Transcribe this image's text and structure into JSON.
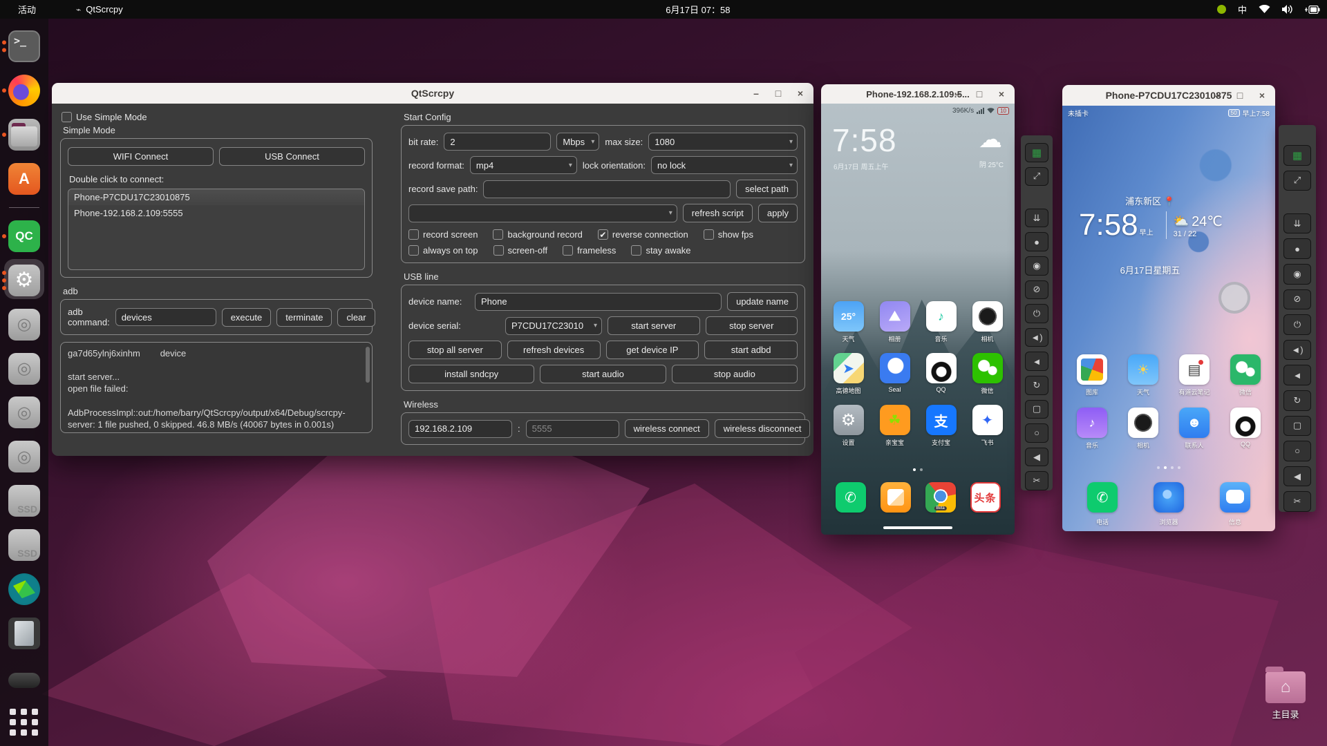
{
  "colors": {
    "topbar": "#0d0d0d",
    "titlebar": "#f3f1ef",
    "window_bg": "#3b3b3b",
    "accent_orange": "#e95420",
    "dock_bg": "rgba(20,14,20,0.82)"
  },
  "topbar": {
    "activities": "活动",
    "app_name": "QtScrcpy",
    "app_glyph": "⌁",
    "clock": "6月17日 07：58",
    "input_method": "中",
    "tray": [
      {
        "icon": "android-icon"
      },
      {
        "icon": "input-method-indicator"
      },
      {
        "icon": "wifi-icon"
      },
      {
        "icon": "volume-icon"
      },
      {
        "icon": "battery-icon"
      }
    ]
  },
  "dock": {
    "items": [
      {
        "name": "terminal",
        "style": "terminal",
        "glyph": ">_",
        "dots": 2
      },
      {
        "name": "firefox",
        "style": "firefox",
        "dots": 1
      },
      {
        "name": "files",
        "style": "files",
        "dots": 1
      },
      {
        "name": "ubuntu-software",
        "style": "soft",
        "glyph": "A",
        "dots": 0
      },
      {
        "name": "separator"
      },
      {
        "name": "qtcreator",
        "style": "qc",
        "glyph": "QC",
        "dots": 1
      },
      {
        "name": "settings-gear",
        "style": "gear",
        "glyph": "⚙",
        "dots": 3,
        "active": true
      },
      {
        "name": "disk-1",
        "style": "disk",
        "glyph": "◎",
        "dots": 0
      },
      {
        "name": "disk-2",
        "style": "disk",
        "glyph": "◎",
        "dots": 0
      },
      {
        "name": "disk-3",
        "style": "disk",
        "glyph": "◎",
        "dots": 0
      },
      {
        "name": "disk-4",
        "style": "disk",
        "glyph": "◎",
        "dots": 0
      },
      {
        "name": "ssd-1",
        "style": "ssd",
        "glyph": "SSD",
        "dots": 0
      },
      {
        "name": "ssd-2",
        "style": "ssd",
        "glyph": "SSD",
        "dots": 0
      },
      {
        "name": "remote-tool",
        "style": "origami",
        "dots": 0
      },
      {
        "name": "phone-device",
        "style": "phone",
        "dots": 0
      },
      {
        "name": "drive-pill",
        "style": "pill",
        "dots": 0
      },
      {
        "name": "show-apps",
        "style": "grid",
        "dots": 0
      }
    ]
  },
  "main_window": {
    "title": "QtScrcpy",
    "controls": {
      "minimize": "–",
      "maximize": "□",
      "close": "×"
    },
    "left": {
      "use_simple_mode": "Use Simple Mode",
      "simple_mode_label": "Simple Mode",
      "wifi_connect": "WIFI Connect",
      "usb_connect": "USB Connect",
      "double_click_label": "Double click to connect:",
      "devices": [
        "Phone-P7CDU17C23010875",
        "Phone-192.168.2.109:5555"
      ],
      "adb_label": "adb",
      "adb_command_label": "adb command:",
      "adb_command_value": "devices",
      "execute": "execute",
      "terminate": "terminate",
      "clear": "clear",
      "console": "ga7d65ylnj6xinhm        device\n\nstart server...\nopen file failed:\n\nAdbProcessImpl::out:/home/barry/QtScrcpy/output/x64/Debug/scrcpy-server: 1 file pushed, 0 skipped. 46.8 MB/s (40067 bytes in 0.001s)"
    },
    "start_config": {
      "title": "Start Config",
      "bit_rate_label": "bit rate:",
      "bit_rate_value": "2",
      "bit_rate_unit": "Mbps",
      "max_size_label": "max size:",
      "max_size_value": "1080",
      "record_format_label": "record format:",
      "record_format_value": "mp4",
      "lock_orientation_label": "lock orientation:",
      "lock_orientation_value": "no lock",
      "record_save_path_label": "record save path:",
      "select_path": "select path",
      "refresh_script": "refresh script",
      "apply": "apply",
      "options_row1": [
        {
          "label": "record screen",
          "checked": false
        },
        {
          "label": "background record",
          "checked": false
        },
        {
          "label": "reverse connection",
          "checked": true
        },
        {
          "label": "show fps",
          "checked": false
        }
      ],
      "options_row2": [
        {
          "label": "always on top",
          "checked": false
        },
        {
          "label": "screen-off",
          "checked": false
        },
        {
          "label": "frameless",
          "checked": false
        },
        {
          "label": "stay awake",
          "checked": false
        }
      ]
    },
    "usb_line": {
      "title": "USB line",
      "device_name_label": "device name:",
      "device_name_value": "Phone",
      "update_name": "update name",
      "device_serial_label": "device serial:",
      "device_serial_value": "P7CDU17C23010",
      "start_server": "start server",
      "stop_server": "stop server",
      "stop_all_server": "stop all server",
      "refresh_devices": "refresh devices",
      "get_device_ip": "get device IP",
      "start_adbd": "start adbd",
      "install_sndcpy": "install sndcpy",
      "start_audio": "start audio",
      "stop_audio": "stop audio"
    },
    "wireless": {
      "title": "Wireless",
      "ip_value": "192.168.2.109",
      "colon": ":",
      "port_placeholder": "5555",
      "connect": "wireless connect",
      "disconnect": "wireless disconnect"
    }
  },
  "phone_toolbar": {
    "buttons": [
      {
        "name": "group-control-icon",
        "glyph": "▦",
        "cls": "green"
      },
      {
        "name": "fullscreen-icon",
        "glyph": "⤢"
      },
      {
        "name": "spacer"
      },
      {
        "name": "expand-icon",
        "glyph": "⇊"
      },
      {
        "name": "screen-toggle-icon",
        "glyph": "●"
      },
      {
        "name": "eye-open-icon",
        "glyph": "◉"
      },
      {
        "name": "eye-closed-icon",
        "glyph": "⊘"
      },
      {
        "name": "power-icon",
        "glyph": "⏻"
      },
      {
        "name": "volume-up-icon",
        "glyph": "◄)"
      },
      {
        "name": "volume-down-icon",
        "glyph": "◄"
      },
      {
        "name": "rotate-icon",
        "glyph": "↻"
      },
      {
        "name": "app-switch-icon",
        "glyph": "▢"
      },
      {
        "name": "home-icon",
        "glyph": "○"
      },
      {
        "name": "back-icon",
        "glyph": "◀"
      },
      {
        "name": "screenshot-icon",
        "glyph": "✂"
      }
    ]
  },
  "phone1": {
    "title": "Phone-192.168.2.109:5...",
    "status_right": "396K/s",
    "battery_badge": "10",
    "clock": "7:58",
    "date": "6月17日 周五上午",
    "cloud_glyph": "☁",
    "weather": "阴 25°C",
    "apps": [
      {
        "label": "天气",
        "style": "weather1",
        "glyph": "25°"
      },
      {
        "label": "相册",
        "style": "gallery",
        "glyph": "⛰"
      },
      {
        "label": "音乐",
        "style": "music",
        "glyph": "♪"
      },
      {
        "label": "相机",
        "style": "camera",
        "glyph": ""
      },
      {
        "label": "高德地图",
        "style": "amap",
        "glyph": "➤"
      },
      {
        "label": "Seal",
        "style": "seal",
        "glyph": ""
      },
      {
        "label": "QQ",
        "style": "qq",
        "glyph": ""
      },
      {
        "label": "微信",
        "style": "wechat",
        "glyph": ""
      },
      {
        "label": "设置",
        "style": "settings1",
        "glyph": "⚙"
      },
      {
        "label": "亲宝宝",
        "style": "qinbaobao",
        "glyph": "☘"
      },
      {
        "label": "支付宝",
        "style": "alipay",
        "glyph": "支"
      },
      {
        "label": "飞书",
        "style": "feishu",
        "glyph": "✦"
      }
    ],
    "page_dots": {
      "count": 2,
      "active": 0
    },
    "dock": [
      {
        "name": "phone-call-app",
        "style": "phoneapp",
        "glyph": "✆"
      },
      {
        "name": "messages-app",
        "style": "msg",
        "glyph": ""
      },
      {
        "name": "chrome-app",
        "style": "chrome",
        "glyph": "",
        "badge": "Beta"
      },
      {
        "name": "toutiao-app",
        "style": "toutiao",
        "glyph": "头条"
      }
    ]
  },
  "phone2": {
    "title": "Phone-P7CDU17C23010875",
    "status_left": "未插卡",
    "battery_badge": "50",
    "status_right": "早上7:58",
    "location": "浦东新区",
    "location_pin": "📍",
    "clock": "7:58",
    "clock_suffix": "早上",
    "sun_glyph": "⛅",
    "temp": "24℃",
    "temp_range": "31 / 22",
    "date": "6月17日星期五",
    "apps": [
      {
        "label": "图库",
        "style": "hgallery",
        "glyph": ""
      },
      {
        "label": "天气",
        "style": "hweather",
        "glyph": "☀"
      },
      {
        "label": "有道云笔记",
        "style": "youdao",
        "glyph": "▤"
      },
      {
        "label": "微信",
        "style": "hwechat",
        "glyph": ""
      },
      {
        "label": "音乐",
        "style": "hmusic",
        "glyph": "♪"
      },
      {
        "label": "相机",
        "style": "camera",
        "glyph": ""
      },
      {
        "label": "联系人",
        "style": "contacts",
        "glyph": "☻"
      },
      {
        "label": "QQ",
        "style": "qq",
        "glyph": ""
      }
    ],
    "page_dots": {
      "count": 4,
      "active": 1
    },
    "dock": [
      {
        "name": "phone-call-app",
        "style": "phoneapp",
        "glyph": "✆",
        "label": "电话"
      },
      {
        "name": "browser-app",
        "style": "browser",
        "glyph": "",
        "label": "浏览器"
      },
      {
        "name": "messages-app",
        "style": "hmsg",
        "glyph": "",
        "label": "信息"
      }
    ]
  },
  "desktop": {
    "home_label": "主目录",
    "home_glyph": "⌂"
  }
}
